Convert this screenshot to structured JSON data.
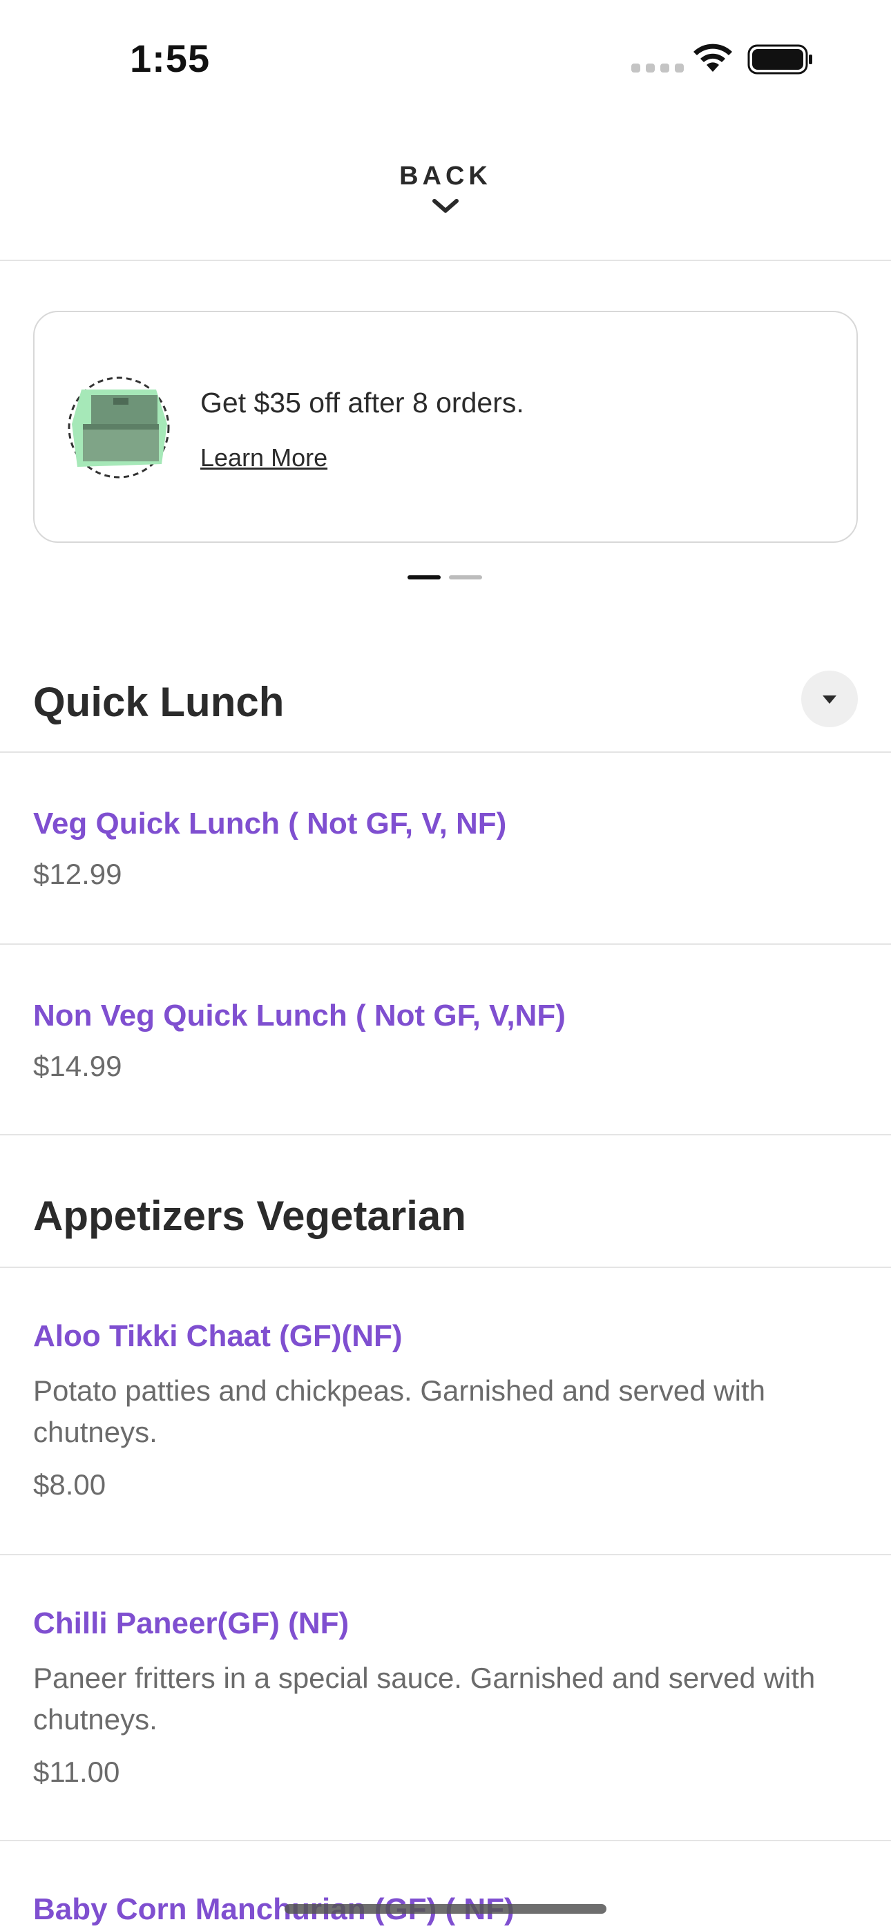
{
  "status_bar": {
    "time": "1:55",
    "icons": [
      "signal-icon",
      "wifi-icon",
      "battery-icon"
    ]
  },
  "header": {
    "back_label": "BACK",
    "back_icon": "chevron-down-icon"
  },
  "promo": {
    "icon": "box-stack-icon",
    "text": "Get $35 off after 8 orders.",
    "link_label": "Learn More",
    "pager_total": 2,
    "pager_active": 1
  },
  "sections": [
    {
      "title": "Quick Lunch",
      "items": [
        {
          "name": "Veg Quick Lunch ( Not GF, V, NF)",
          "price": "$12.99"
        },
        {
          "name": "Non Veg Quick Lunch ( Not GF, V,NF)",
          "price": "$14.99"
        }
      ]
    },
    {
      "title": "Appetizers Vegetarian",
      "items": [
        {
          "name": "Aloo Tikki Chaat (GF)(NF)",
          "description": "Potato patties and chickpeas. Garnished and served with chutneys.",
          "price": "$8.00"
        },
        {
          "name": "Chilli Paneer(GF) (NF)",
          "description": "Paneer fritters in a special sauce. Garnished and served with chutneys.",
          "price": "$11.00"
        },
        {
          "name": "Baby Corn Manchurian (GF) ( NF)"
        }
      ]
    }
  ],
  "colors": {
    "accent": "#7f4fd0",
    "text": "#2b2b2b",
    "muted": "#6b6b6b",
    "divider": "#e4e4e4",
    "promo_icon_glow": "#a6e8b8"
  }
}
